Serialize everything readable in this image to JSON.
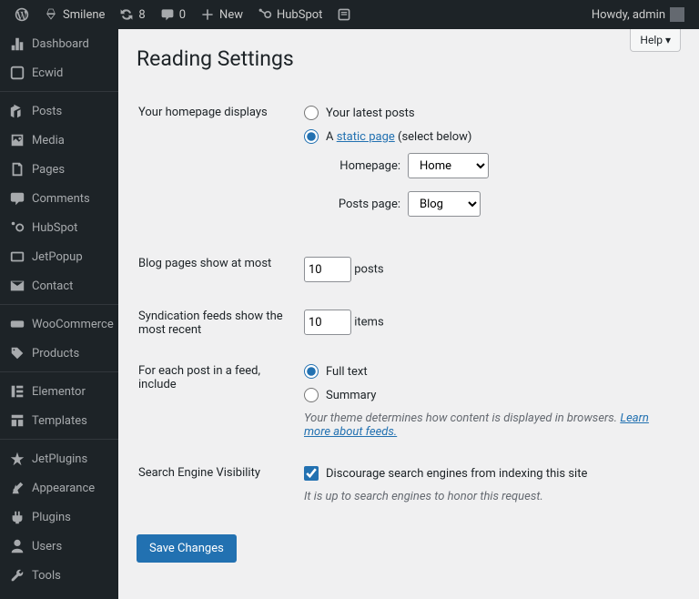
{
  "adminbar": {
    "site": "Smilene",
    "updates": "8",
    "comments": "0",
    "new": "New",
    "hubspot": "HubSpot",
    "howdy": "Howdy, admin"
  },
  "sidebar": {
    "items": [
      {
        "label": "Dashboard"
      },
      {
        "label": "Ecwid"
      },
      {
        "sep": true
      },
      {
        "label": "Posts"
      },
      {
        "label": "Media"
      },
      {
        "label": "Pages"
      },
      {
        "label": "Comments"
      },
      {
        "label": "HubSpot"
      },
      {
        "label": "JetPopup"
      },
      {
        "label": "Contact"
      },
      {
        "sep": true
      },
      {
        "label": "WooCommerce"
      },
      {
        "label": "Products"
      },
      {
        "sep": true
      },
      {
        "label": "Elementor"
      },
      {
        "label": "Templates"
      },
      {
        "sep": true
      },
      {
        "label": "JetPlugins"
      },
      {
        "label": "Appearance"
      },
      {
        "label": "Plugins"
      },
      {
        "label": "Users"
      },
      {
        "label": "Tools"
      }
    ]
  },
  "page": {
    "help": "Help ▾",
    "title": "Reading Settings",
    "rows": {
      "homepage": {
        "label": "Your homepage displays",
        "opt1": "Your latest posts",
        "opt2_prefix": "A ",
        "opt2_link": "static page",
        "opt2_suffix": " (select below)",
        "homepage_label": "Homepage:",
        "homepage_value": "Home",
        "postspage_label": "Posts page:",
        "postspage_value": "Blog"
      },
      "blogpages": {
        "label": "Blog pages show at most",
        "value": "10",
        "unit": "posts"
      },
      "syndication": {
        "label": "Syndication feeds show the most recent",
        "value": "10",
        "unit": "items"
      },
      "feed": {
        "label": "For each post in a feed, include",
        "opt1": "Full text",
        "opt2": "Summary",
        "desc_prefix": "Your theme determines how content is displayed in browsers. ",
        "desc_link": "Learn more about feeds.",
        "desc_suffix": ""
      },
      "visibility": {
        "label": "Search Engine Visibility",
        "check": "Discourage search engines from indexing this site",
        "desc": "It is up to search engines to honor this request."
      }
    },
    "save": "Save Changes"
  }
}
